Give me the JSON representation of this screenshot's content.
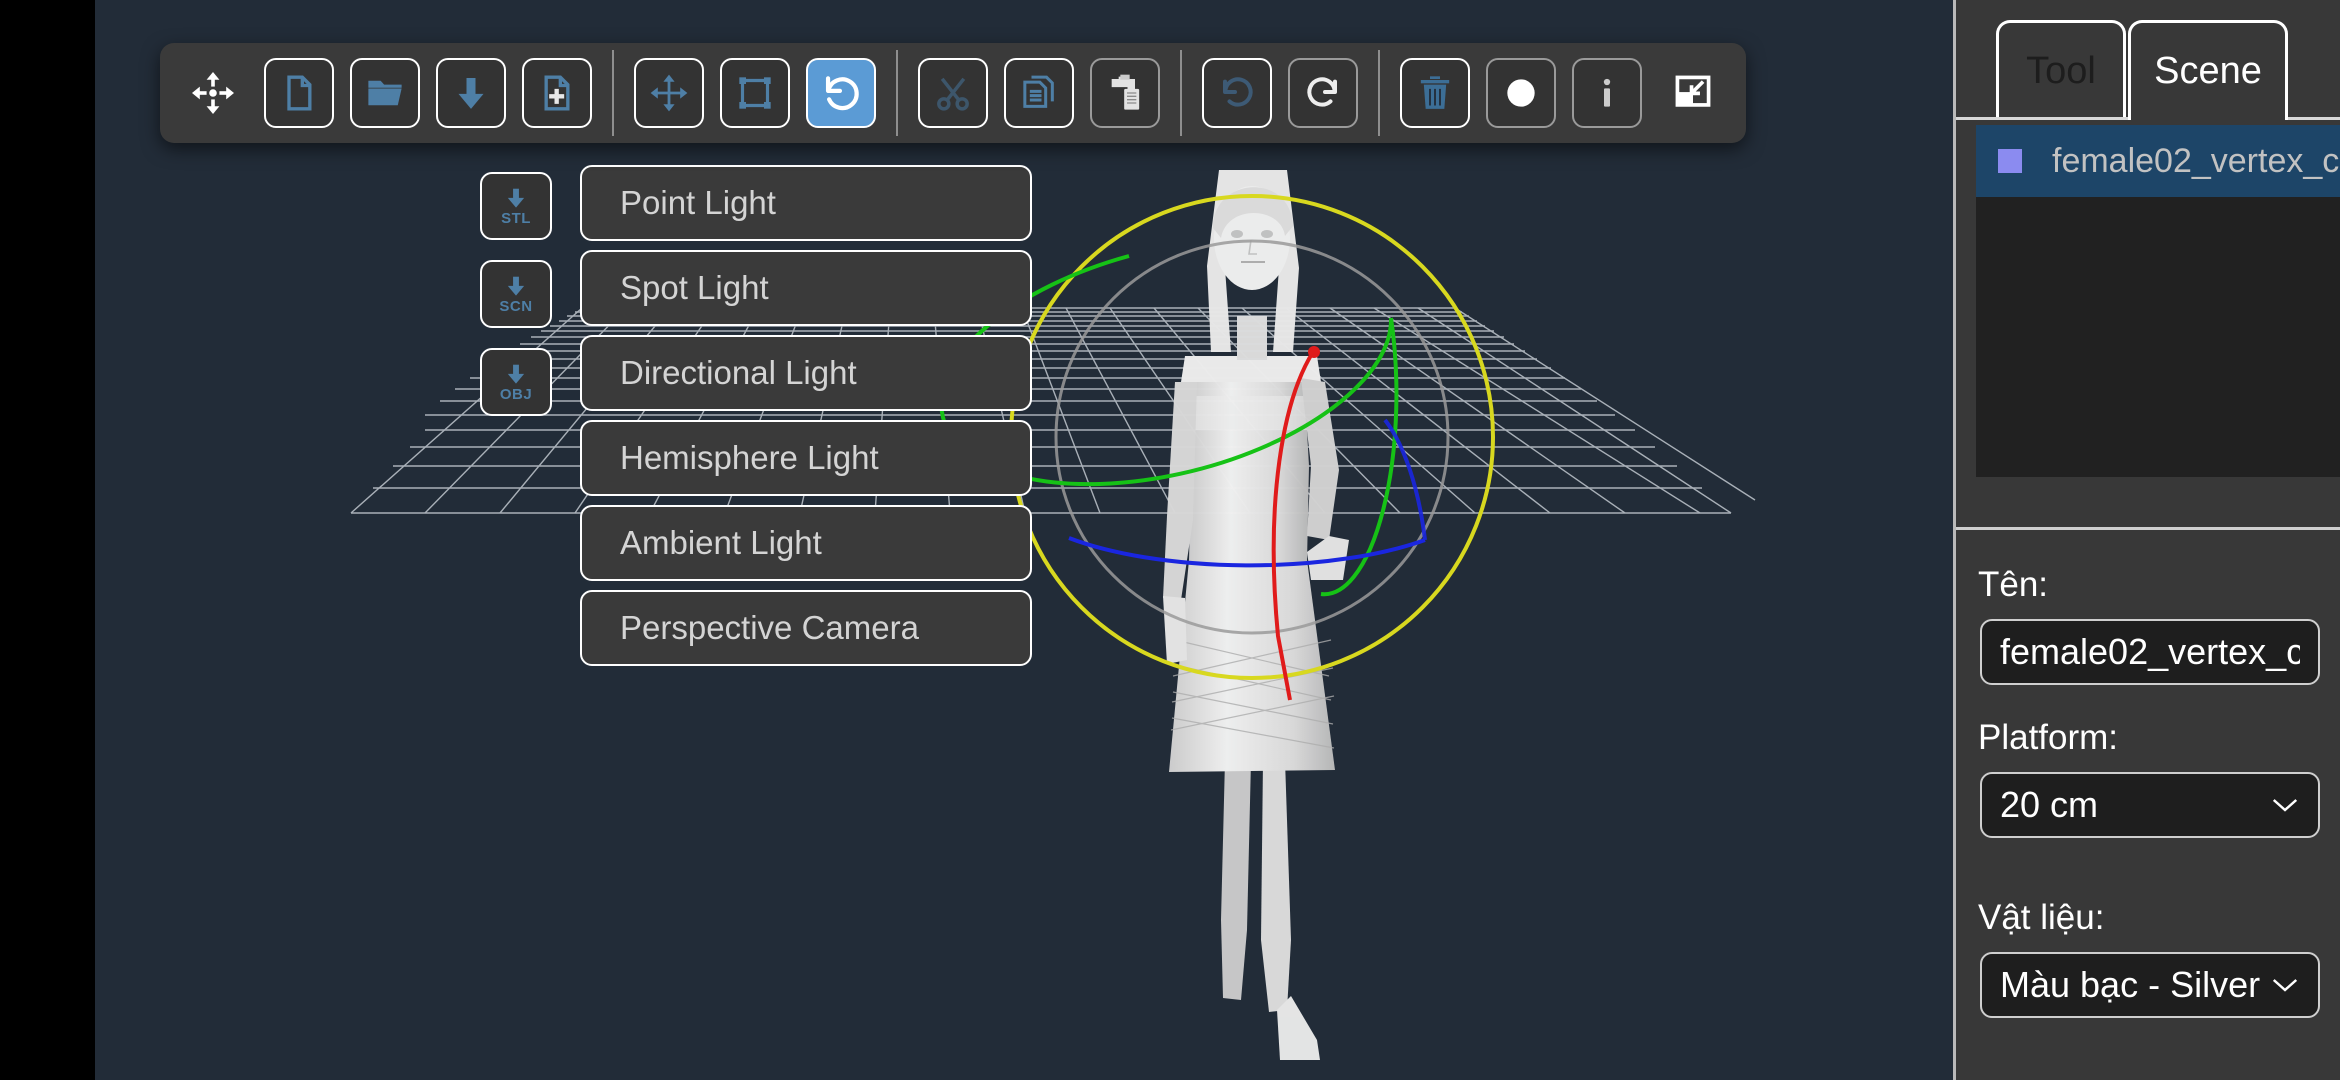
{
  "app": {
    "viewport_bg": "#222c38",
    "accent": "#5b9bd5",
    "panel_bg": "#383838"
  },
  "toolbar": {
    "groups": [
      {
        "buttons": [
          {
            "name": "pan-move-icon",
            "icon": "move-4way-white",
            "style": "plain",
            "label": ""
          },
          {
            "name": "new-file-button",
            "icon": "file",
            "style": "outlined",
            "label": ""
          },
          {
            "name": "open-folder-button",
            "icon": "folder",
            "style": "outlined",
            "label": ""
          },
          {
            "name": "import-download-button",
            "icon": "arrow-down",
            "style": "outlined",
            "label": ""
          },
          {
            "name": "add-file-button",
            "icon": "file-plus",
            "style": "outlined",
            "label": ""
          }
        ]
      },
      {
        "buttons": [
          {
            "name": "translate-tool-button",
            "icon": "move-4way-blue",
            "style": "outlined",
            "label": ""
          },
          {
            "name": "scale-tool-button",
            "icon": "scale-frame",
            "style": "outlined",
            "label": ""
          },
          {
            "name": "rotate-tool-button",
            "icon": "rotate-ccw",
            "style": "active",
            "label": ""
          }
        ]
      },
      {
        "buttons": [
          {
            "name": "cut-button",
            "icon": "scissors",
            "style": "outlined",
            "label": ""
          },
          {
            "name": "copy-button",
            "icon": "copy-pages",
            "style": "outlined",
            "label": ""
          },
          {
            "name": "paste-button",
            "icon": "clipboard",
            "style": "dim",
            "label": ""
          }
        ]
      },
      {
        "buttons": [
          {
            "name": "undo-button",
            "icon": "undo-arrow",
            "style": "outlined",
            "label": ""
          },
          {
            "name": "redo-button",
            "icon": "redo-arrow",
            "style": "dim",
            "label": ""
          }
        ]
      },
      {
        "buttons": [
          {
            "name": "delete-button",
            "icon": "trash",
            "style": "outlined",
            "label": ""
          },
          {
            "name": "record-button",
            "icon": "circle-filled",
            "style": "dim",
            "label": ""
          },
          {
            "name": "info-button",
            "icon": "info-i",
            "style": "dim",
            "label": ""
          },
          {
            "name": "restore-window-button",
            "icon": "restore-down",
            "style": "plain",
            "label": ""
          }
        ]
      }
    ]
  },
  "export_buttons": [
    {
      "name": "export-stl-button",
      "label": "STL"
    },
    {
      "name": "export-scn-button",
      "label": "SCN"
    },
    {
      "name": "export-obj-button",
      "label": "OBJ"
    }
  ],
  "add_menu": {
    "items": [
      {
        "name": "menu-item-point-light",
        "label": "Point Light"
      },
      {
        "name": "menu-item-spot-light",
        "label": "Spot Light"
      },
      {
        "name": "menu-item-directional-light",
        "label": "Directional Light"
      },
      {
        "name": "menu-item-hemisphere-light",
        "label": "Hemisphere Light"
      },
      {
        "name": "menu-item-ambient-light",
        "label": "Ambient Light"
      },
      {
        "name": "menu-item-perspective-camera",
        "label": "Perspective Camera"
      }
    ]
  },
  "right_panel": {
    "tabs": [
      {
        "name": "tab-tool",
        "label": "Tool",
        "active": false
      },
      {
        "name": "tab-scene",
        "label": "Scene",
        "active": true
      }
    ],
    "scene_list": [
      {
        "name": "scene-item-female02",
        "label": "female02_vertex_c",
        "swatch": "#8b8bf0",
        "selected": true
      }
    ],
    "fields": {
      "name_label": "Tên:",
      "name_value": "female02_vertex_c",
      "platform_label": "Platform:",
      "platform_value": "20 cm",
      "material_label": "Vật liệu:",
      "material_value": "Màu bạc - Silver"
    }
  },
  "viewport": {
    "gizmo": {
      "x_axis_color": "#e01b1b",
      "y_axis_color": "#16c216",
      "z_axis_color": "#1a26e0",
      "outer_ring_color": "#d8d81f",
      "screen_ring_color": "#9a9a9a"
    },
    "grid_color": "#b8bfc6",
    "model_color": "#e4e4e4"
  }
}
